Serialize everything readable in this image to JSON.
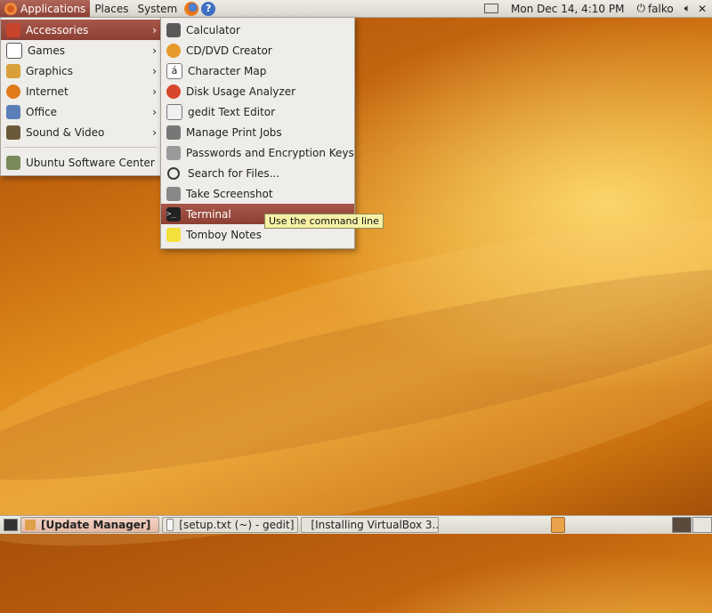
{
  "top_panel": {
    "menus": [
      "Applications",
      "Places",
      "System"
    ],
    "clock": "Mon Dec 14,  4:10 PM",
    "user": "falko"
  },
  "applications_menu": {
    "items": [
      {
        "label": "Accessories",
        "icon": "accessories-icon",
        "color": "#c8442c"
      },
      {
        "label": "Games",
        "icon": "games-icon",
        "color": "#555555"
      },
      {
        "label": "Graphics",
        "icon": "graphics-icon",
        "color": "#d9a03a"
      },
      {
        "label": "Internet",
        "icon": "internet-icon",
        "color": "#e07a1a"
      },
      {
        "label": "Office",
        "icon": "office-icon",
        "color": "#5a7fb8"
      },
      {
        "label": "Sound & Video",
        "icon": "sound-video-icon",
        "color": "#6b5a3a"
      }
    ],
    "software_center": "Ubuntu Software Center"
  },
  "accessories_menu": {
    "items": [
      {
        "label": "Calculator",
        "icon": "calculator-icon",
        "color": "#5a5a5a"
      },
      {
        "label": "CD/DVD Creator",
        "icon": "cd-dvd-creator-icon",
        "color": "#e69a2a"
      },
      {
        "label": "Character Map",
        "icon": "character-map-icon",
        "color": "#ffffff"
      },
      {
        "label": "Disk Usage Analyzer",
        "icon": "disk-usage-analyzer-icon",
        "color": "#d9472a"
      },
      {
        "label": "gedit Text Editor",
        "icon": "gedit-icon",
        "color": "#f0f0f0"
      },
      {
        "label": "Manage Print Jobs",
        "icon": "printer-icon",
        "color": "#777777"
      },
      {
        "label": "Passwords and Encryption Keys",
        "icon": "keys-icon",
        "color": "#9a9a9a"
      },
      {
        "label": "Search for Files...",
        "icon": "search-icon",
        "color": "#3a3a3a"
      },
      {
        "label": "Take Screenshot",
        "icon": "camera-icon",
        "color": "#888888"
      },
      {
        "label": "Terminal",
        "icon": "terminal-icon",
        "color": "#222222"
      },
      {
        "label": "Tomboy Notes",
        "icon": "tomboy-notes-icon",
        "color": "#f3e03a"
      }
    ],
    "tooltip": "Use the command line"
  },
  "taskbar": {
    "tasks": [
      {
        "label": "[Update Manager]",
        "active": true
      },
      {
        "label": "[setup.txt (~) - gedit]",
        "active": false
      },
      {
        "label": "[Installing VirtualBox 3...",
        "active": false
      }
    ]
  }
}
